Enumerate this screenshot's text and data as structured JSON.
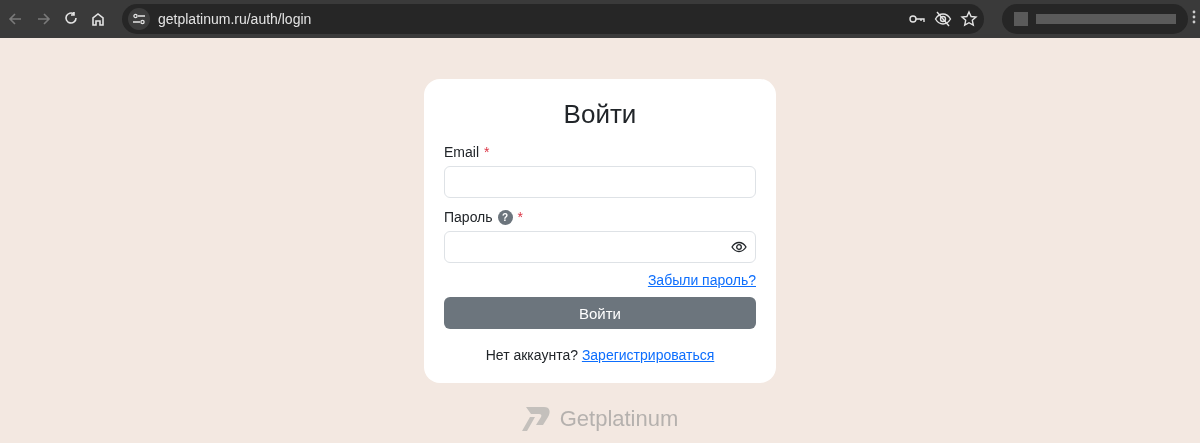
{
  "browser": {
    "nav": [
      {
        "kind": "back",
        "disabled": true
      },
      {
        "kind": "forward",
        "disabled": true
      },
      {
        "kind": "reload",
        "disabled": false
      },
      {
        "kind": "home",
        "disabled": false
      }
    ],
    "url": "getplatinum.ru/auth/login"
  },
  "login": {
    "title": "Войти",
    "fields": [
      {
        "label": "Email",
        "required_mark": "*",
        "kind": "text"
      },
      {
        "label": "Пароль",
        "help": "?",
        "required_mark": "*",
        "kind": "password"
      }
    ],
    "forgot_link": "Забыли пароль?",
    "submit": "Войти",
    "signup_text": "Нет аккаунта?",
    "signup_link": "Зарегистрироваться"
  },
  "footer": {
    "brand": "Getplatinum"
  }
}
